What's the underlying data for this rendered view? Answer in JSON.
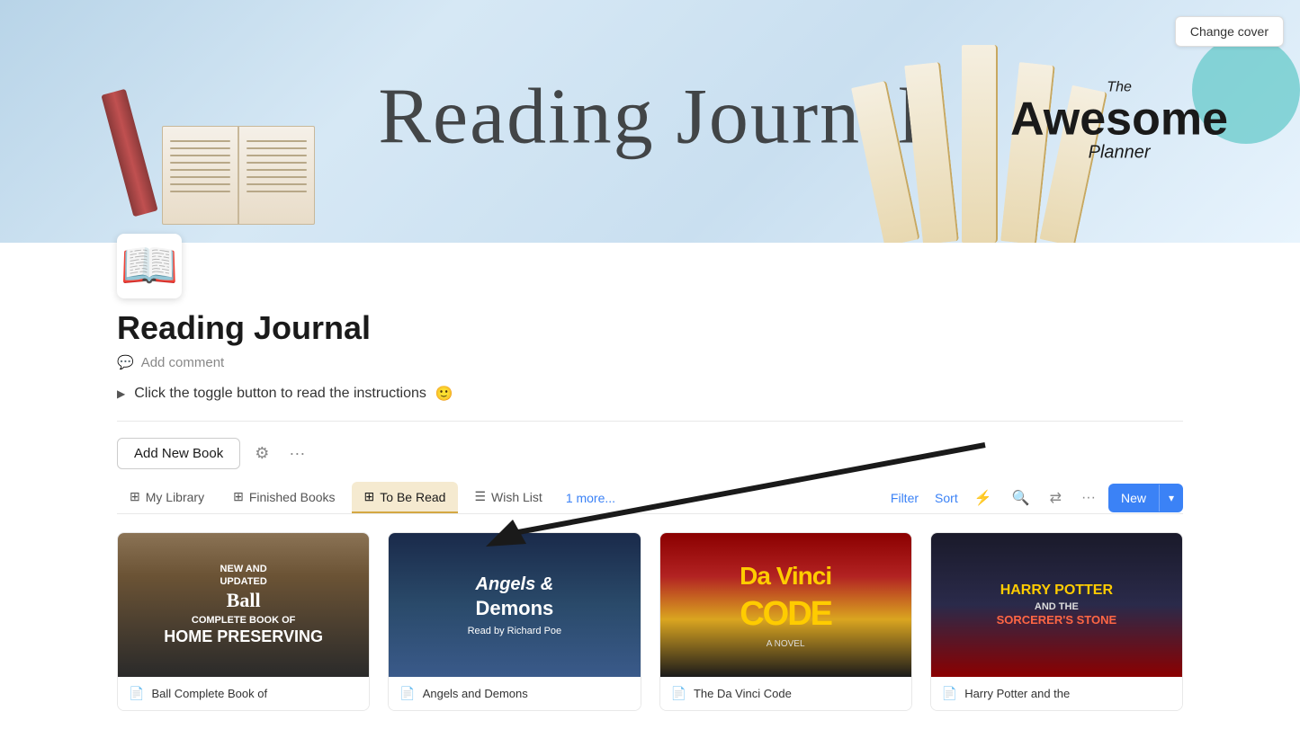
{
  "banner": {
    "title": "Reading Journal",
    "change_cover_label": "Change cover",
    "logo": {
      "the": "The",
      "awesome": "Awesome",
      "planner": "Planner"
    }
  },
  "page": {
    "icon": "📖",
    "title": "Reading Journal",
    "add_comment": "Add comment",
    "toggle_text": "Click the toggle button to read the instructions",
    "toggle_emoji": "🙂"
  },
  "toolbar": {
    "add_book_label": "Add New Book",
    "settings_icon": "⚙",
    "more_icon": "···"
  },
  "tabs": [
    {
      "id": "my-library",
      "label": "My Library",
      "icon": "⊞",
      "active": false
    },
    {
      "id": "finished-books",
      "label": "Finished Books",
      "icon": "⊞",
      "active": false
    },
    {
      "id": "to-be-read",
      "label": "To Be Read",
      "icon": "⊞",
      "active": true
    },
    {
      "id": "wish-list",
      "label": "Wish List",
      "icon": "☰",
      "active": false
    }
  ],
  "more_tabs_label": "1 more...",
  "actions": {
    "filter_label": "Filter",
    "sort_label": "Sort",
    "new_label": "New"
  },
  "books": [
    {
      "title": "Ball Complete Book of",
      "cover_text": "COMPLETE BOOK OF\nHOME PRESERVING",
      "cover_class": "cover-1"
    },
    {
      "title": "Angels and Demons",
      "cover_text": "ANGELS & DEMONS",
      "cover_class": "cover-2"
    },
    {
      "title": "The Da Vinci Code",
      "cover_text": "Da Vinci\nCODE",
      "cover_class": "cover-3"
    },
    {
      "title": "Harry Potter and the",
      "cover_text": "HARRY POTTER\nand the\nSorcerer's Stone",
      "cover_class": "cover-4"
    }
  ]
}
